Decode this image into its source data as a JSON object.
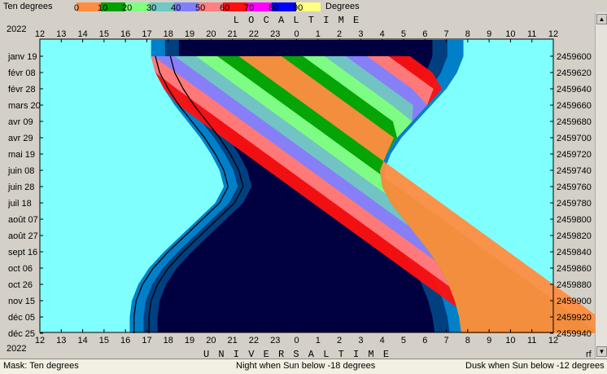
{
  "header": {
    "mask_label": "Ten degrees",
    "units_label": "Degrees",
    "scale": [
      {
        "label": "0",
        "color": "#ff8c40"
      },
      {
        "label": "10",
        "color": "#00a000"
      },
      {
        "label": "20",
        "color": "#80ff80"
      },
      {
        "label": "30",
        "color": "#70c8c0"
      },
      {
        "label": "40",
        "color": "#8080ff"
      },
      {
        "label": "50",
        "color": "#ff8080"
      },
      {
        "label": "60",
        "color": "#ff1010"
      },
      {
        "label": "70",
        "color": "#ff00ff"
      },
      {
        "label": "80",
        "color": "#0000ff"
      },
      {
        "label": "90",
        "color": "#ffff80"
      }
    ]
  },
  "chart_data": {
    "type": "heatmap",
    "title_top": "L O C A L   T I M E",
    "title_bottom": "U N I V E R S A L   T I M E",
    "year_top": "2022",
    "year_bottom": "2022",
    "corner_label": "rf",
    "hour_ticks": [
      "12",
      "13",
      "14",
      "15",
      "16",
      "17",
      "18",
      "19",
      "20",
      "21",
      "22",
      "23",
      "0",
      "1",
      "2",
      "3",
      "4",
      "5",
      "6",
      "7",
      "8",
      "9",
      "10",
      "11",
      "12"
    ],
    "date_labels": [
      "janv 19",
      "févr 08",
      "févr 28",
      "mars 20",
      "avr 09",
      "avr 29",
      "mai 19",
      "juin 08",
      "juin 28",
      "juil 18",
      "août 07",
      "août 27",
      "sept 16",
      "oct 06",
      "oct 26",
      "nov 15",
      "déc 05",
      "déc 25"
    ],
    "jd_labels": [
      "2459600",
      "2459620",
      "2459640",
      "2459660",
      "2459680",
      "2459700",
      "2459720",
      "2459740",
      "2459760",
      "2459780",
      "2459800",
      "2459820",
      "2459840",
      "2459860",
      "2459880",
      "2459900",
      "2459920",
      "2459940"
    ],
    "colors": {
      "day": "#80ffff",
      "civil": "#0080c8",
      "nautical": "#004080",
      "night": "#000040",
      "curve": "#000000"
    },
    "bands_altitude_deg": [
      0,
      10,
      20,
      30,
      40,
      50,
      60
    ],
    "night_threshold": "Sun below -18 degrees",
    "dusk_threshold": "Sun below -12 degrees"
  },
  "status": {
    "mask": "Mask:  Ten degrees",
    "night": "Night when Sun below -18 degrees",
    "dusk": "Dusk when Sun below -12 degrees"
  }
}
